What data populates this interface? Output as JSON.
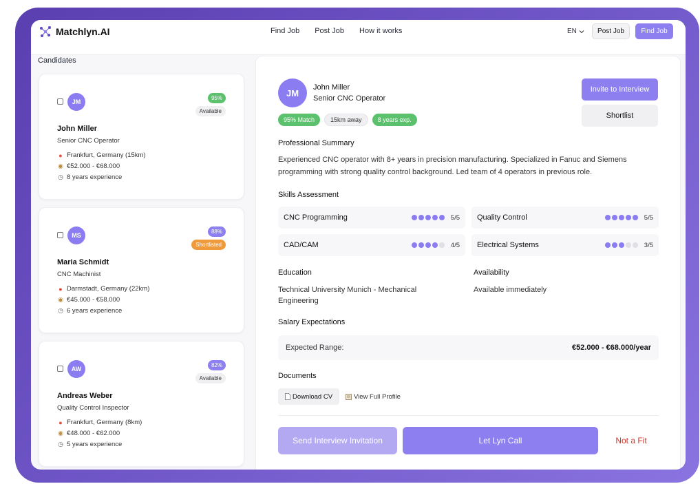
{
  "colors": {
    "accent": "#8d7ff0",
    "accent_light": "#b3a9f3",
    "match_green": "#5bc16d",
    "shortlisted_orange": "#ef9b3c",
    "danger": "#d4342a",
    "frame_gradient": [
      "#5a3fb0",
      "#8a74e0"
    ]
  },
  "header": {
    "brand": "Matchlyn.AI",
    "brand_icon": "network-logo-icon",
    "nav": [
      "Find Job",
      "Post Job",
      "How it works"
    ],
    "language": "EN",
    "post_job_label": "Post Job",
    "find_job_label": "Find Job"
  },
  "candidates": {
    "title": "Candidates",
    "items": [
      {
        "initials": "JM",
        "match": "95%",
        "status": "Available",
        "name": "John Miller",
        "role": "Senior CNC Operator",
        "location": "Frankfurt, Germany (15km)",
        "salary": "€52.000 - €68.000",
        "experience": "8 years experience"
      },
      {
        "initials": "MS",
        "match": "88%",
        "status": "Shortlisted",
        "name": "Maria Schmidt",
        "role": "CNC Machinist",
        "location": "Darmstadt, Germany (22km)",
        "salary": "€45.000 - €58.000",
        "experience": "6 years experience"
      },
      {
        "initials": "AW",
        "match": "82%",
        "status": "Available",
        "name": "Andreas Weber",
        "role": "Quality Control Inspector",
        "location": "Frankfurt, Germany (8km)",
        "salary": "€48.000 - €62.000",
        "experience": "5 years experience"
      }
    ]
  },
  "detail": {
    "initials": "JM",
    "name": "John Miller",
    "role": "Senior CNC Operator",
    "tags": [
      "95% Match",
      "15km away",
      "8 years exp."
    ],
    "invite_label": "Invite to Interview",
    "shortlist_label": "Shortlist",
    "summary_title": "Professional Summary",
    "summary": "Experienced CNC operator with 8+ years in precision manufacturing. Specialized in Fanuc and Siemens programming with strong quality control background. Led team of 4 operators in previous role.",
    "skills_title": "Skills Assessment",
    "skills": [
      {
        "name": "CNC Programming",
        "level": 5,
        "max": 5,
        "score": "5/5"
      },
      {
        "name": "Quality Control",
        "level": 5,
        "max": 5,
        "score": "5/5"
      },
      {
        "name": "CAD/CAM",
        "level": 4,
        "max": 5,
        "score": "4/5"
      },
      {
        "name": "Electrical Systems",
        "level": 3,
        "max": 5,
        "score": "3/5"
      }
    ],
    "education_title": "Education",
    "education": "Technical University Munich - Mechanical Engineering",
    "availability_title": "Availability",
    "availability": "Available immediately",
    "salary_title": "Salary Expectations",
    "salary_key": "Expected Range:",
    "salary_value": "€52.000 - €68.000/year",
    "documents_title": "Documents",
    "download_cv": "Download CV",
    "view_profile": "View Full Profile",
    "send_invitation": "Send Interview Invitation",
    "lyn_call": "Let Lyn Call",
    "not_fit": "Not a Fit"
  }
}
